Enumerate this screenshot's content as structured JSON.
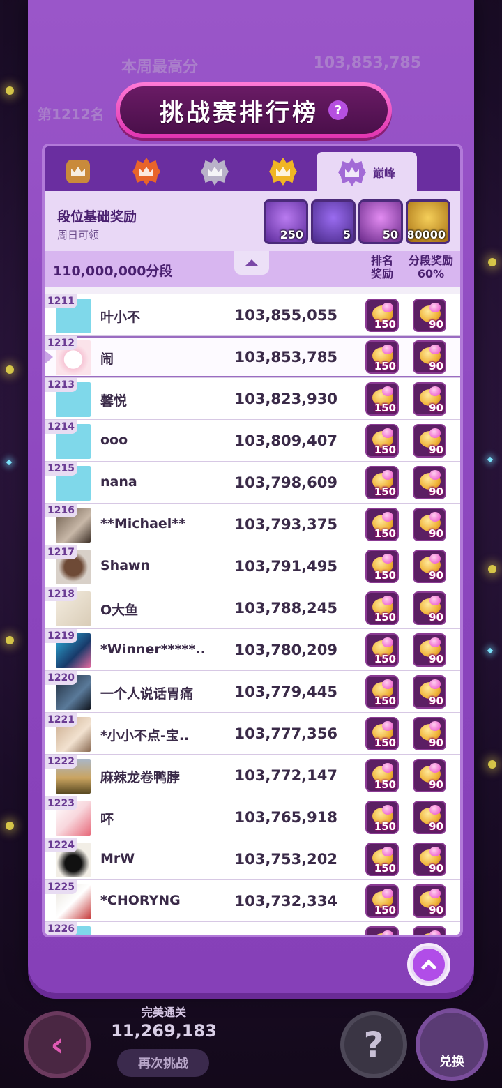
{
  "background": {
    "top_label": "本周最高分",
    "top_score": "103,853,785",
    "rank_label": "第1212名",
    "perfect_label": "完美通关",
    "perfect_score": "11,269,183",
    "retry_label": "再次挑战",
    "exchange_label": "兑换"
  },
  "title": "挑战赛排行榜",
  "help_glyph": "?",
  "tabs": [
    {
      "icon": "bronze-crown-icon",
      "color": "#c98a3b"
    },
    {
      "icon": "orange-crown-icon",
      "color": "#e8642a"
    },
    {
      "icon": "silver-crown-icon",
      "color": "#b9b2c9"
    },
    {
      "icon": "gold-crown-icon",
      "color": "#f0b524"
    },
    {
      "icon": "purple-crown-icon",
      "color": "#a26ad6",
      "label": "巅峰",
      "active": true
    }
  ],
  "base_reward": {
    "title": "段位基础奖励",
    "subtitle": "周日可领",
    "items": [
      {
        "icon": "purple-tokens-icon",
        "qty": "250"
      },
      {
        "icon": "ticket-card-icon",
        "qty": "5"
      },
      {
        "icon": "pink-gems-icon",
        "qty": "50"
      },
      {
        "icon": "gold-coins-icon",
        "qty": "80000"
      }
    ]
  },
  "header": {
    "segment": "110,000,000分段",
    "col_rank_reward": [
      "排名",
      "奖励"
    ],
    "col_segment_reward": [
      "分段奖励",
      "60%"
    ]
  },
  "rows": [
    {
      "rank": "1211",
      "name": "叶小不",
      "score": "103,855,055",
      "r1": "150",
      "r2": "90",
      "avatar": "teddy",
      "me": false
    },
    {
      "rank": "1212",
      "name": "闹",
      "score": "103,853,785",
      "r1": "150",
      "r2": "90",
      "avatar": "bunny",
      "me": true
    },
    {
      "rank": "1213",
      "name": "馨悦",
      "score": "103,823,930",
      "r1": "150",
      "r2": "90",
      "avatar": "teddy",
      "me": false
    },
    {
      "rank": "1214",
      "name": "ooo",
      "score": "103,809,407",
      "r1": "150",
      "r2": "90",
      "avatar": "teddy",
      "me": false
    },
    {
      "rank": "1215",
      "name": "nana",
      "score": "103,798,609",
      "r1": "150",
      "r2": "90",
      "avatar": "teddy",
      "me": false
    },
    {
      "rank": "1216",
      "name": "**Michael**",
      "score": "103,793,375",
      "r1": "150",
      "r2": "90",
      "avatar": "photo-brown",
      "me": false
    },
    {
      "rank": "1217",
      "name": "Shawn",
      "score": "103,791,495",
      "r1": "150",
      "r2": "90",
      "avatar": "photo-dog",
      "me": false
    },
    {
      "rank": "1218",
      "name": "O大鱼",
      "score": "103,788,245",
      "r1": "150",
      "r2": "90",
      "avatar": "photo-sketch",
      "me": false
    },
    {
      "rank": "1219",
      "name": "*Winner*****..",
      "score": "103,780,209",
      "r1": "150",
      "r2": "90",
      "avatar": "photo-anime",
      "me": false
    },
    {
      "rank": "1220",
      "name": "一个人说话胃痛",
      "score": "103,779,445",
      "r1": "150",
      "r2": "90",
      "avatar": "photo-dark",
      "me": false
    },
    {
      "rank": "1221",
      "name": "*小小不点-宝..",
      "score": "103,777,356",
      "r1": "150",
      "r2": "90",
      "avatar": "photo-child",
      "me": false
    },
    {
      "rank": "1222",
      "name": "麻辣龙卷鸭脖",
      "score": "103,772,147",
      "r1": "150",
      "r2": "90",
      "avatar": "photo-field",
      "me": false
    },
    {
      "rank": "1223",
      "name": "吥",
      "score": "103,765,918",
      "r1": "150",
      "r2": "90",
      "avatar": "photo-cartoon",
      "me": false
    },
    {
      "rank": "1224",
      "name": "MrW",
      "score": "103,753,202",
      "r1": "150",
      "r2": "90",
      "avatar": "photo-bw",
      "me": false
    },
    {
      "rank": "1225",
      "name": "*CHORYNG",
      "score": "103,732,334",
      "r1": "150",
      "r2": "90",
      "avatar": "photo-bear",
      "me": false
    },
    {
      "rank": "1226",
      "name": "",
      "score": "",
      "r1": "",
      "r2": "",
      "avatar": "teddy",
      "me": false
    }
  ]
}
